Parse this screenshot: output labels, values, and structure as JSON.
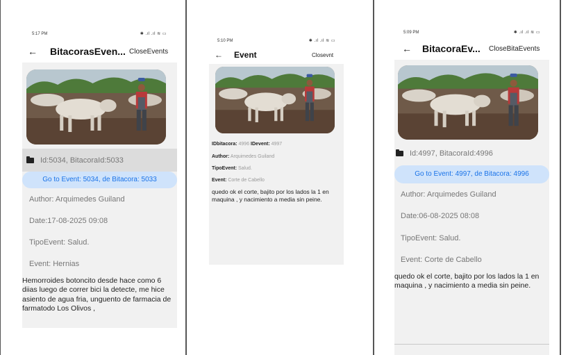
{
  "screen1": {
    "status": {
      "time": "5:17 PM",
      "icons": "✱ .ıl .ıl ≋ ▭"
    },
    "appbar": {
      "back": "←",
      "title": "BitacorasEven...",
      "action": "CloseEvents"
    },
    "id_line": "Id:5034, BitacoraId:5033",
    "go_button": "Go to Event:  5034, de Bitacora: 5033",
    "author": "Author: Arquimedes Guiland",
    "date": "Date:17-08-2025 09:08",
    "tipo": "TipoEvent: Salud.",
    "event": "Event: Hernias",
    "body": "Hemorroides botoncito desde hace como 6 diias luego de correr bici la detecte, me hice asiento de agua fria, unguento de farmacia de farmatodo Los Olivos ,"
  },
  "screen2": {
    "status": {
      "time": "5:10 PM",
      "icons": "✱ .ıl .ıl ≋ ▭"
    },
    "appbar": {
      "back": "←",
      "title": "Event",
      "action": "Closevnt"
    },
    "ids": {
      "k1": "IDbitacora:",
      "v1": "4996",
      "k2": "IDevent:",
      "v2": "4997"
    },
    "author": {
      "k": "Author:",
      "v": "Arquimedes Guiland"
    },
    "tipo": {
      "k": "TipoEvent:",
      "v": "Salud."
    },
    "event": {
      "k": "Event:",
      "v": "Corte de Cabello"
    },
    "body": "quedo ok el corte, bajito por los lados la 1 en maquina , y nacimiento a media sin peine."
  },
  "screen3": {
    "status": {
      "time": "5:09 PM",
      "icons": "✱ .ıl .ıl ≋ ▭"
    },
    "appbar": {
      "back": "←",
      "title": "BitacoraEv...",
      "action": "CloseBitaEvents"
    },
    "id_line": "Id:4997, BitacoraId:4996",
    "go_button": "Go to Event:  4997, de Bitacora: 4996",
    "author": "Author: Arquimedes Guiland",
    "date": "Date:06-08-2025 08:08",
    "tipo": "TipoEvent: Salud.",
    "event": "Event: Corte de Cabello",
    "body": "quedo ok el corte, bajito por los lados la 1 en maquina , y nacimiento a media sin peine."
  }
}
